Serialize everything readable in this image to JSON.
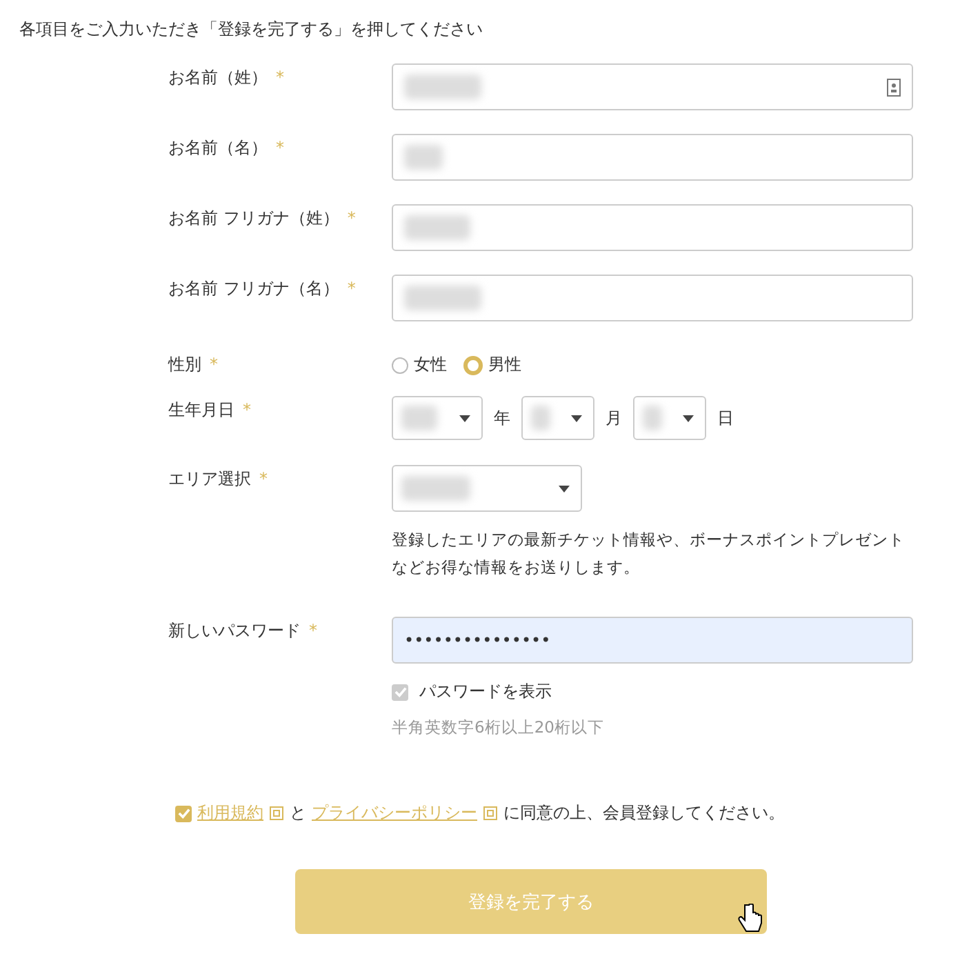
{
  "intro": "各項目をご入力いただき「登録を完了する」を押してください",
  "fields": [
    {
      "kind": "text",
      "label": "お名前（姓）",
      "required": "*",
      "autofill_icon": true
    },
    {
      "kind": "text",
      "label": "お名前（名）",
      "required": "*",
      "autofill_icon": false
    },
    {
      "kind": "text",
      "label": "お名前 フリガナ（姓）",
      "required": "*",
      "autofill_icon": false
    },
    {
      "kind": "text",
      "label": "お名前 フリガナ（名）",
      "required": "*",
      "autofill_icon": false
    },
    {
      "kind": "radio",
      "label": "性別",
      "required": "*",
      "options": [
        {
          "label": "女性",
          "selected": false
        },
        {
          "label": "男性",
          "selected": true
        }
      ]
    },
    {
      "kind": "date",
      "label": "生年月日",
      "required": "*",
      "parts": [
        {
          "unit": "年"
        },
        {
          "unit": "月"
        },
        {
          "unit": "日"
        }
      ]
    },
    {
      "kind": "select",
      "label": "エリア選択",
      "required": "*",
      "note": "登録したエリアの最新チケット情報や、ボーナスポイントプレゼントなどお得な情報をお送りします。"
    },
    {
      "kind": "password",
      "label": "新しいパスワード",
      "required": "*",
      "value": "•••••••••••••••",
      "autofilled": true,
      "show_label": "パスワードを表示",
      "show_checked": true,
      "hint": "半角英数字6桁以上20桁以下"
    }
  ],
  "agreement": {
    "checked": true,
    "terms_link": "利用規約",
    "joiner": "と",
    "privacy_link": "プライバシーポリシー",
    "text": "に同意の上、会員登録してください。"
  },
  "submit": {
    "label": "登録を完了する",
    "disabled": true
  }
}
